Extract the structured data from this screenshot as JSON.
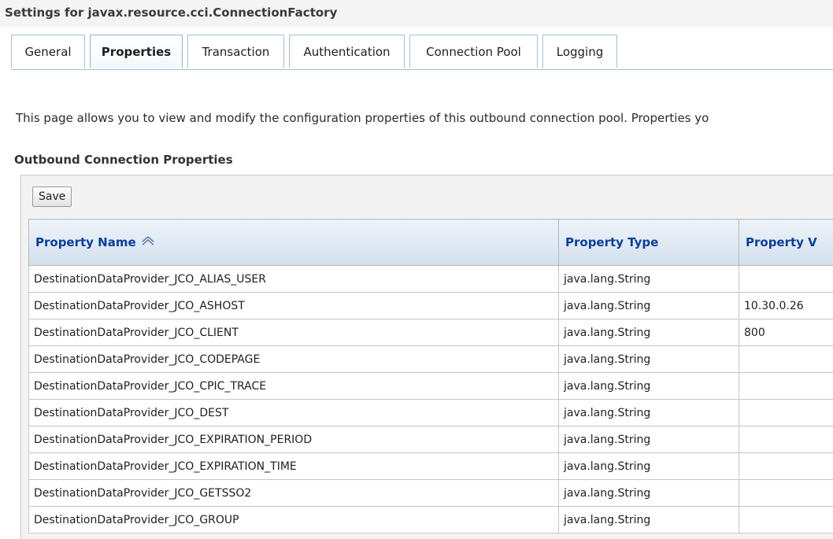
{
  "page_title": "Settings for javax.resource.cci.ConnectionFactory",
  "tabs": [
    {
      "label": "General",
      "active": false
    },
    {
      "label": "Properties",
      "active": true
    },
    {
      "label": "Transaction",
      "active": false
    },
    {
      "label": "Authentication",
      "active": false
    },
    {
      "label": "Connection Pool",
      "active": false
    },
    {
      "label": "Logging",
      "active": false
    }
  ],
  "description": "This page allows you to view and modify the configuration properties of this outbound connection pool. Properties yo",
  "section": {
    "title": "Outbound Connection Properties",
    "save_label": "Save"
  },
  "table": {
    "headers": {
      "name": "Property Name",
      "type": "Property Type",
      "value": "Property V"
    },
    "sort": {
      "column": "Property Name",
      "icon": "sort-ascending-icon"
    },
    "rows": [
      {
        "name": "DestinationDataProvider_JCO_ALIAS_USER",
        "type": "java.lang.String",
        "value": ""
      },
      {
        "name": "DestinationDataProvider_JCO_ASHOST",
        "type": "java.lang.String",
        "value": "10.30.0.26"
      },
      {
        "name": "DestinationDataProvider_JCO_CLIENT",
        "type": "java.lang.String",
        "value": "800"
      },
      {
        "name": "DestinationDataProvider_JCO_CODEPAGE",
        "type": "java.lang.String",
        "value": ""
      },
      {
        "name": "DestinationDataProvider_JCO_CPIC_TRACE",
        "type": "java.lang.String",
        "value": ""
      },
      {
        "name": "DestinationDataProvider_JCO_DEST",
        "type": "java.lang.String",
        "value": ""
      },
      {
        "name": "DestinationDataProvider_JCO_EXPIRATION_PERIOD",
        "type": "java.lang.String",
        "value": ""
      },
      {
        "name": "DestinationDataProvider_JCO_EXPIRATION_TIME",
        "type": "java.lang.String",
        "value": ""
      },
      {
        "name": "DestinationDataProvider_JCO_GETSSO2",
        "type": "java.lang.String",
        "value": ""
      },
      {
        "name": "DestinationDataProvider_JCO_GROUP",
        "type": "java.lang.String",
        "value": ""
      }
    ]
  },
  "colors": {
    "header_text": "#0b3e99",
    "tab_border": "#a7bfd4",
    "title_bar": "#f4f4f4",
    "panel": "#f3f3f3"
  }
}
